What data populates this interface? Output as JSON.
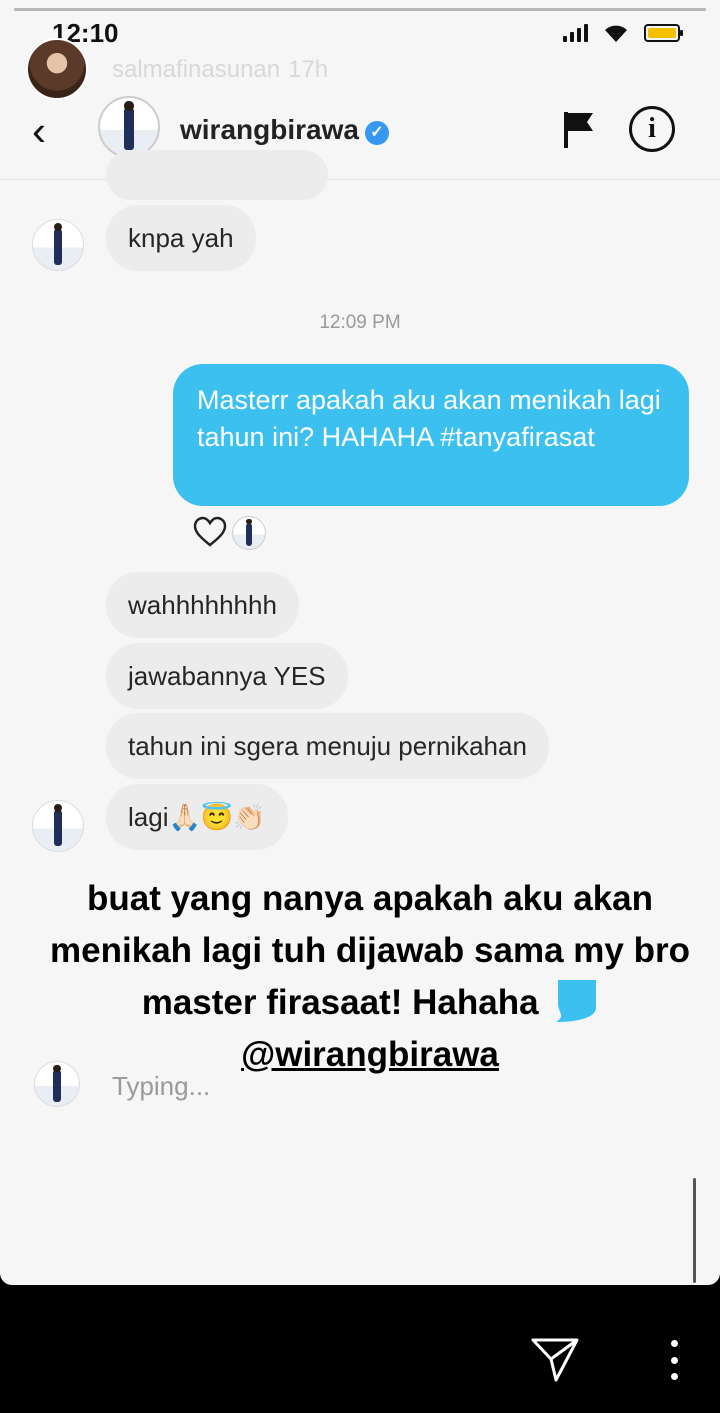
{
  "status_bar": {
    "time": "12:10"
  },
  "story": {
    "username": "salmafinasunan",
    "age": "17h"
  },
  "chat_header": {
    "back_icon": "chevron-left-icon",
    "username": "wirangbirawa",
    "verified_icon": "verified-badge-icon",
    "flag_icon": "flag-icon",
    "info_icon": "info-icon",
    "info_glyph": "i"
  },
  "messages": {
    "received_top": "knpa yah",
    "timestamp": "12:09 PM",
    "sent": "Masterr apakah aku akan menikah lagi tahun ini? HAHAHA #tanyafirasat",
    "received": [
      "wahhhhhhhh",
      "jawabannya YES",
      "tahun ini sgera menuju pernikahan",
      "lagi🙏🏻😇👏🏻"
    ]
  },
  "caption": {
    "text": "buat yang nanya apakah aku akan menikah lagi tuh dijawab sama my bro master firasaat! Hahaha",
    "mention": "@wirangbirawa"
  },
  "typing": "Typing...",
  "colors": {
    "sent_bubble": "#3cc0f0",
    "received_bubble": "#ececec",
    "verified": "#3897f0",
    "battery": "#f5c000"
  },
  "footer": {
    "send_icon": "paper-plane-icon",
    "more_icon": "more-vertical-icon"
  }
}
